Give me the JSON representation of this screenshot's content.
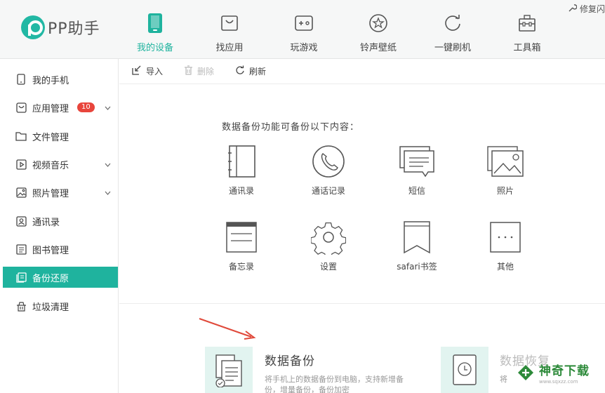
{
  "app": {
    "logo_text": "PP助手",
    "repair_label": "修复闪"
  },
  "nav": [
    {
      "label": "我的设备",
      "icon": "phone-icon"
    },
    {
      "label": "找应用",
      "icon": "bag-icon"
    },
    {
      "label": "玩游戏",
      "icon": "gamepad-icon"
    },
    {
      "label": "铃声壁纸",
      "icon": "star-icon"
    },
    {
      "label": "一键刷机",
      "icon": "refresh-icon"
    },
    {
      "label": "工具箱",
      "icon": "toolbox-icon"
    }
  ],
  "sidebar": {
    "items": [
      {
        "label": "我的手机",
        "icon": "phone-icon"
      },
      {
        "label": "应用管理",
        "icon": "app-icon",
        "badge": "10"
      },
      {
        "label": "文件管理",
        "icon": "folder-icon"
      },
      {
        "label": "视频音乐",
        "icon": "play-icon"
      },
      {
        "label": "照片管理",
        "icon": "photo-icon"
      },
      {
        "label": "通讯录",
        "icon": "contacts-icon"
      },
      {
        "label": "图书管理",
        "icon": "book-icon"
      },
      {
        "label": "备份还原",
        "icon": "backup-icon"
      },
      {
        "label": "垃圾清理",
        "icon": "trash-icon"
      }
    ]
  },
  "toolbar": {
    "import_label": "导入",
    "delete_label": "删除",
    "refresh_label": "刷新"
  },
  "main": {
    "intro": "数据备份功能可备份以下内容：",
    "categories": [
      {
        "label": "通讯录",
        "icon": "contacts-book-icon"
      },
      {
        "label": "通话记录",
        "icon": "phone-call-icon"
      },
      {
        "label": "短信",
        "icon": "sms-icon"
      },
      {
        "label": "照片",
        "icon": "photos-icon"
      },
      {
        "label": "备忘录",
        "icon": "memo-icon"
      },
      {
        "label": "设置",
        "icon": "settings-icon"
      },
      {
        "label": "safari书签",
        "icon": "bookmark-icon"
      },
      {
        "label": "其他",
        "icon": "more-icon"
      }
    ],
    "backup_card": {
      "title": "数据备份",
      "desc": "将手机上的数据备份到电脑，支持新增备份，增量备份，备份加密"
    },
    "restore_card": {
      "title": "数据恢复",
      "desc": "将"
    }
  },
  "watermark": {
    "text": "神奇下载",
    "sub": "www.sqxzz.com"
  },
  "colors": {
    "accent": "#1fb39e",
    "badge": "#e8453c",
    "arrow": "#e0493a"
  }
}
